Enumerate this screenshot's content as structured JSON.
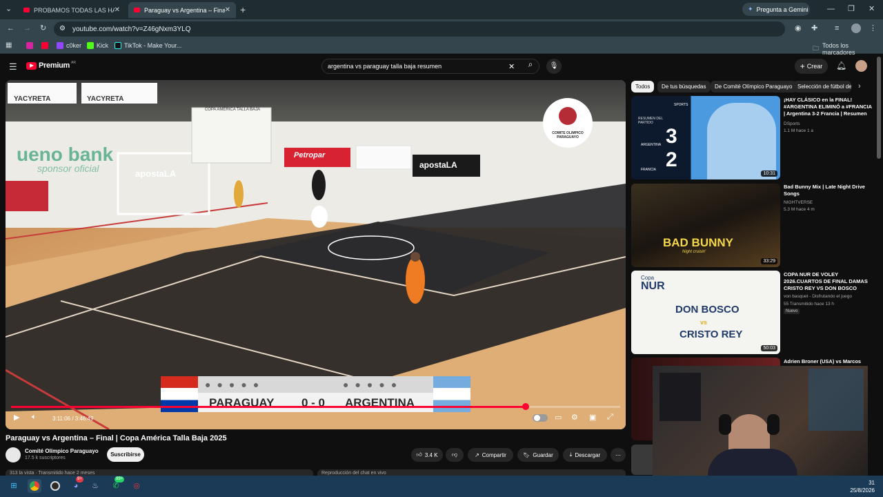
{
  "tabs": [
    {
      "title": "PROBAMOS TODAS LAS HAMB",
      "active": false
    },
    {
      "title": "Paraguay vs Argentina – Final |",
      "active": true
    }
  ],
  "gemini_label": "Pregunta a Gemini",
  "url": "youtube.com/watch?v=Z46gNxm3YLQ",
  "bookmarks": [
    "c0ker",
    "Kick",
    "TikTok - Make Your..."
  ],
  "all_bookmarks": "Todos los marcadores",
  "youtube": {
    "logo": "Premium",
    "region": "AR",
    "search_value": "argentina vs paraguay talla baja resumen",
    "create_label": "Crear"
  },
  "player": {
    "timecode": "3:11:06 / 3:46:49",
    "progress_fraction": 0.845,
    "scoreboard": {
      "home": "PARAGUAY",
      "score": "0 - 0",
      "away": "ARGENTINA"
    },
    "court_signs": [
      "YACYRETA",
      "YACYRETA",
      "ueno bank",
      "sponsor oficial",
      "apostaLA",
      "Petropar",
      "apostaLA",
      "COPA AMÉRICA TALLA BAJA"
    ],
    "logo_text": "COMITE OLIMPICO PARAGUAYO"
  },
  "video": {
    "title": "Paraguay vs Argentina – Final | Copa América Talla Baja 2025",
    "channel": "Comité Olímpico Paraguayo",
    "subscribers": "17.5 k suscriptores",
    "subscribe_label": "Suscribirse",
    "likes": "3.4 K",
    "share_label": "Compartir",
    "save_label": "Guardar",
    "download_label": "Descargar",
    "below_left": "313 la vista · Transmitido hace 2 meses",
    "below_right": "Reproducción del chat en vivo"
  },
  "chips": [
    "Todos",
    "De tus búsquedas",
    "De Comité Olímpico Paraguayo",
    "Selección de fútbol de"
  ],
  "recommendations": [
    {
      "title": "¡HAY CLÁSICO en la FINAL! #ARGENTINA ELIMINÓ a #FRANCIA | Argentina 3-2 Francia | Resumen",
      "channel": "DSports",
      "meta": "1.1 M  hace 1 a",
      "duration": "10:31",
      "thumb_texts": [
        "RESUMEN DEL PARTIDO",
        "3",
        "2",
        "ARGENTINA",
        "FRANCIA",
        "SPORTS"
      ]
    },
    {
      "title": "Bad Bunny Mix | Late Night Drive Songs",
      "channel": "NIGHTVERSE",
      "meta": "5.3 M  hace 4 m",
      "duration": "33:29",
      "thumb_texts": [
        "BAD BUNNY",
        "Night cruisin'"
      ]
    },
    {
      "title": "COPA NUR DE VOLEY 2026.CUARTOS DE FINAL DAMAS CRISTO REY VS DON BOSCO",
      "channel": "von basquet - Disfrutando el juego",
      "meta": "55  Transmitido hace 13 h",
      "badge": "Nuevo",
      "duration": "50:03",
      "thumb_texts": [
        "Copa",
        "NUR",
        "DON BOSCO",
        "vs",
        "CRISTO REY"
      ]
    },
    {
      "title": "Adrien Broner (USA) vs Marcos",
      "channel": "",
      "meta": "",
      "duration": "",
      "thumb_texts": []
    }
  ],
  "taskbar": {
    "time": "31",
    "date": "25/8/2026",
    "badges": [
      "9+",
      "99+"
    ]
  }
}
